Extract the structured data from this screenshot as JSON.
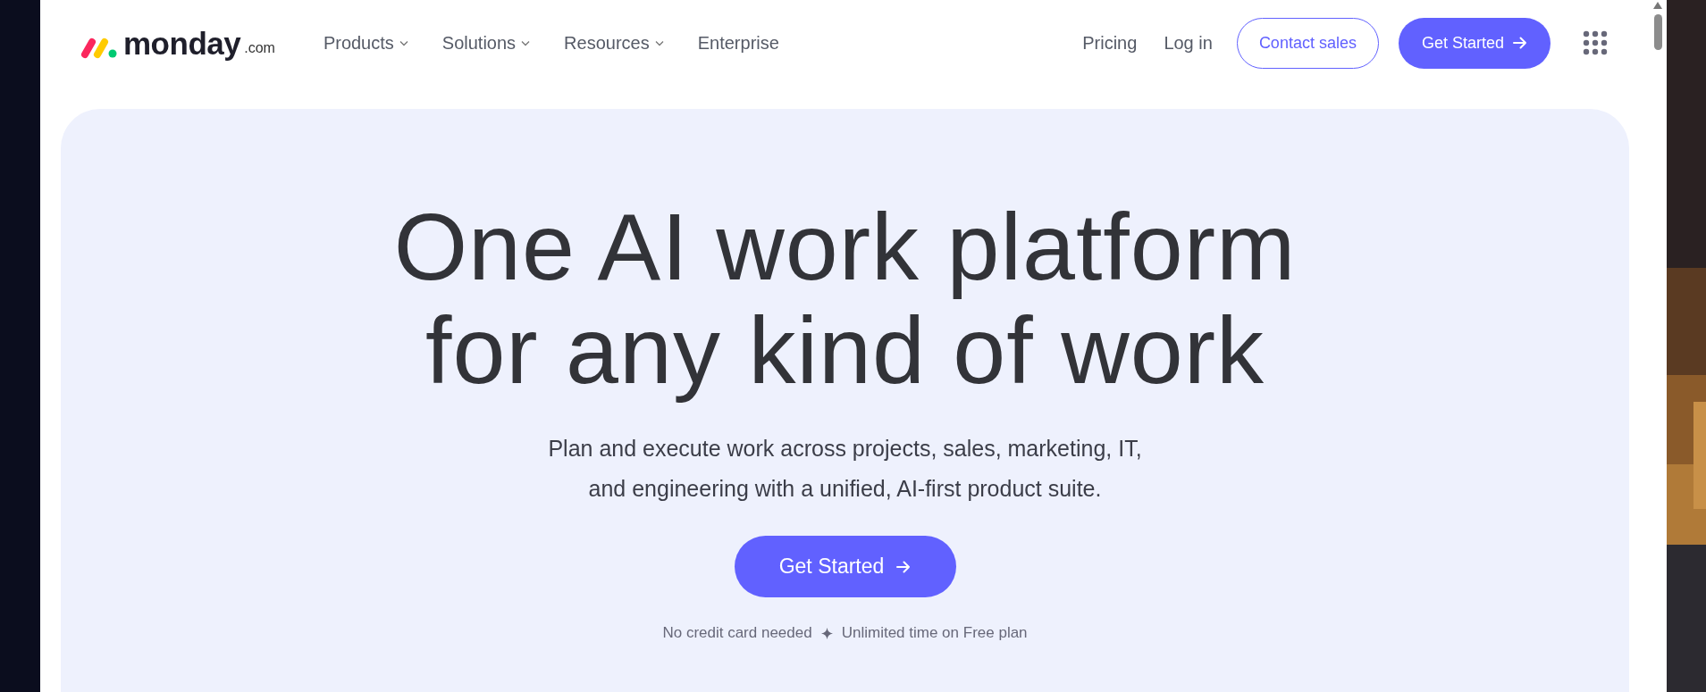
{
  "header": {
    "logo": {
      "wordmark": "monday",
      "suffix": ".com"
    },
    "nav": [
      {
        "label": "Products",
        "kind": "dropdown"
      },
      {
        "label": "Solutions",
        "kind": "dropdown"
      },
      {
        "label": "Resources",
        "kind": "dropdown"
      },
      {
        "label": "Enterprise",
        "kind": "link"
      }
    ],
    "links": [
      "Pricing",
      "Log in"
    ],
    "contact_button": "Contact sales",
    "cta_button": "Get Started"
  },
  "hero": {
    "title_lines": [
      "One AI work platform",
      "for any kind of work"
    ],
    "subtitle_lines": [
      "Plan and execute work across projects, sales, marketing, IT,",
      "and engineering with a unified, AI-first product suite."
    ],
    "cta_button": "Get Started",
    "notes": [
      "No credit card needed",
      "Unlimited time on Free plan"
    ]
  }
}
